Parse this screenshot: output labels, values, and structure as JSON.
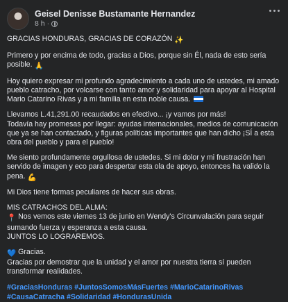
{
  "post": {
    "author": "Geisel Denisse Bustamante Hernandez",
    "time": "8 h",
    "separator": "·"
  },
  "icons": {
    "sparkles": "✨",
    "pray": "🙏",
    "muscle": "💪",
    "pin": "📍",
    "heart": "💙"
  },
  "content": {
    "p1": "GRACIAS HONDURAS, GRACIAS DE CORAZÓN",
    "p2": "Primero y por encima de todo, gracias a Dios, porque sin Él, nada de esto sería posible.",
    "p3": "Hoy quiero expresar mi profundo agradecimiento a cada uno de ustedes, mi amado pueblo catracho, por volcarse con tanto amor y solidaridad para apoyar al Hospital Mario Catarino Rivas y a mi familia en esta noble causa.",
    "p4_line1": "Llevamos L.41,291.00 recaudados en efectivo... ¡y vamos por más!",
    "p4_line2": "Todavía hay promesas por llegar: ayudas internacionales, medios de comunicación que ya se han contactado, y figuras políticas importantes que han dicho ¡SÍ a esta obra del pueblo y para el pueblo!",
    "p5": "Me siento profundamente orgullosa de ustedes. Si mi dolor y mi frustración han servido de imagen y eco para despertar esta ola de apoyo, entonces ha valido la pena.",
    "p6": "Mi Dios tiene formas peculiares de hacer sus obras.",
    "p7_line1": "MIS CATRACHOS DEL ALMA:",
    "p7_line2": "Nos vemos este viernes 13 de junio en Wendy's Circunvalación para seguir sumando fuerza y esperanza a esta causa.",
    "p7_line3": "JUNTOS LO LOGRAREMOS.",
    "p8_line1": "Gracias.",
    "p8_line2": "Gracias por demostrar que la unidad y el amor por nuestra tierra sí pueden transformar realidades."
  },
  "hashtags": [
    "#GraciasHonduras",
    "#JuntosSomosMásFuertes",
    "#MarioCatarinoRivas",
    "#CausaCatracha",
    "#Solidaridad",
    "#HondurasUnida"
  ],
  "colors": {
    "background": "#242526",
    "text": "#e4e6eb",
    "secondary": "#b0b3b8",
    "link": "#4599ff"
  }
}
